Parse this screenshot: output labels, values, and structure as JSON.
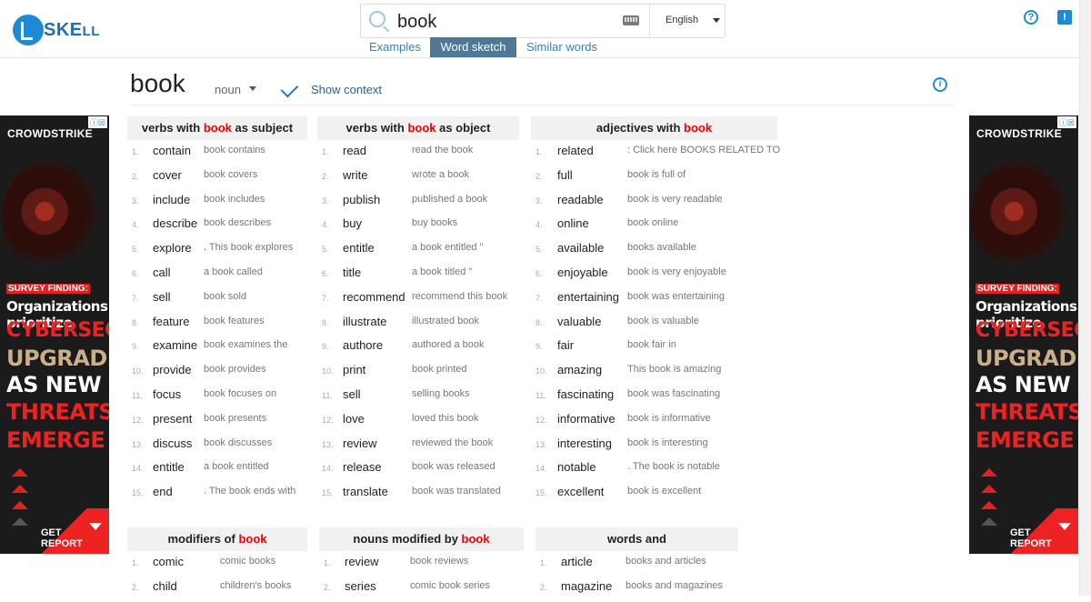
{
  "app": {
    "logo_text": "SKE",
    "logo_suffix": "LL"
  },
  "search": {
    "query": "book",
    "language": "English"
  },
  "nav_tabs": [
    {
      "label": "Examples",
      "active": false
    },
    {
      "label": "Word sketch",
      "active": true
    },
    {
      "label": "Similar words",
      "active": false
    }
  ],
  "icons": {
    "help": "?",
    "feedback": "!",
    "info": "i"
  },
  "entry": {
    "headword": "book",
    "pos": "noun",
    "show_context_label": "Show context",
    "show_context_checked": true
  },
  "columns": [
    {
      "title_pre": "verbs with ",
      "title_kw": "book",
      "title_post": " as subject",
      "rows": [
        {
          "n": "1.",
          "w": "contain",
          "e": "book contains"
        },
        {
          "n": "2.",
          "w": "cover",
          "e": "book covers"
        },
        {
          "n": "3.",
          "w": "include",
          "e": "book includes"
        },
        {
          "n": "4.",
          "w": "describe",
          "e": "book describes"
        },
        {
          "n": "5.",
          "w": "explore",
          "e": ". This book explores"
        },
        {
          "n": "6.",
          "w": "call",
          "e": "a book called"
        },
        {
          "n": "7.",
          "w": "sell",
          "e": "book sold"
        },
        {
          "n": "8.",
          "w": "feature",
          "e": "book features"
        },
        {
          "n": "9.",
          "w": "examine",
          "e": "book examines the"
        },
        {
          "n": "10.",
          "w": "provide",
          "e": "book provides"
        },
        {
          "n": "11.",
          "w": "focus",
          "e": "book focuses on"
        },
        {
          "n": "12.",
          "w": "present",
          "e": "book presents"
        },
        {
          "n": "13.",
          "w": "discuss",
          "e": "book discusses"
        },
        {
          "n": "14.",
          "w": "entitle",
          "e": "a book entitled"
        },
        {
          "n": "15.",
          "w": "end",
          "e": ". The book ends with"
        }
      ]
    },
    {
      "title_pre": "verbs with ",
      "title_kw": "book",
      "title_post": " as object",
      "rows": [
        {
          "n": "1.",
          "w": "read",
          "e": "read the book"
        },
        {
          "n": "2.",
          "w": "write",
          "e": "wrote a book"
        },
        {
          "n": "3.",
          "w": "publish",
          "e": "published a book"
        },
        {
          "n": "4.",
          "w": "buy",
          "e": "buy books"
        },
        {
          "n": "5.",
          "w": "entitle",
          "e": "a book entitled \""
        },
        {
          "n": "6.",
          "w": "title",
          "e": "a book titled \""
        },
        {
          "n": "7.",
          "w": "recommend",
          "e": "recommend this book"
        },
        {
          "n": "8.",
          "w": "illustrate",
          "e": "illustrated book"
        },
        {
          "n": "9.",
          "w": "authore",
          "e": "authored a book"
        },
        {
          "n": "10.",
          "w": "print",
          "e": "book printed"
        },
        {
          "n": "11.",
          "w": "sell",
          "e": "selling books"
        },
        {
          "n": "12.",
          "w": "love",
          "e": "loved this book"
        },
        {
          "n": "13.",
          "w": "review",
          "e": "reviewed the book"
        },
        {
          "n": "14.",
          "w": "release",
          "e": "book was released"
        },
        {
          "n": "15.",
          "w": "translate",
          "e": "book was translated"
        }
      ]
    },
    {
      "title_pre": "adjectives with ",
      "title_kw": "book",
      "title_post": "",
      "rows": [
        {
          "n": "1.",
          "w": "related",
          "e": ": Click here BOOKS RELATED TO"
        },
        {
          "n": "2.",
          "w": "full",
          "e": "book is full of"
        },
        {
          "n": "3.",
          "w": "readable",
          "e": "book is very readable"
        },
        {
          "n": "4.",
          "w": "online",
          "e": "book online"
        },
        {
          "n": "5.",
          "w": "available",
          "e": "books available"
        },
        {
          "n": "6.",
          "w": "enjoyable",
          "e": "book is very enjoyable"
        },
        {
          "n": "7.",
          "w": "entertaining",
          "e": "book was entertaining"
        },
        {
          "n": "8.",
          "w": "valuable",
          "e": "book is valuable"
        },
        {
          "n": "9.",
          "w": "fair",
          "e": "book fair in"
        },
        {
          "n": "10.",
          "w": "amazing",
          "e": "This book is amazing"
        },
        {
          "n": "11.",
          "w": "fascinating",
          "e": "book was fascinating"
        },
        {
          "n": "12.",
          "w": "informative",
          "e": "book is informative"
        },
        {
          "n": "13.",
          "w": "interesting",
          "e": "book is interesting"
        },
        {
          "n": "14.",
          "w": "notable",
          "e": ". The book is notable"
        },
        {
          "n": "15.",
          "w": "excellent",
          "e": "book is excellent"
        }
      ]
    },
    {
      "title_pre": "modifiers of ",
      "title_kw": "book",
      "title_post": "",
      "rows": [
        {
          "n": "1.",
          "w": "comic",
          "e": "comic books"
        },
        {
          "n": "2.",
          "w": "child",
          "e": "children's books"
        }
      ]
    },
    {
      "title_pre": "nouns modified by ",
      "title_kw": "book",
      "title_post": "",
      "rows": [
        {
          "n": "1.",
          "w": "review",
          "e": "book reviews"
        },
        {
          "n": "2.",
          "w": "series",
          "e": "comic book series"
        }
      ]
    },
    {
      "title_pre": "words and",
      "title_kw": "",
      "title_post": "",
      "rows": [
        {
          "n": "1.",
          "w": "article",
          "e": "books and articles"
        },
        {
          "n": "2.",
          "w": "magazine",
          "e": "books and magazines"
        }
      ]
    }
  ],
  "ad": {
    "brand": "CROWDSTRIKE",
    "survey": "SURVEY FINDING:",
    "line1": "Organizations prioritize",
    "line2": "CYBERSECURITY",
    "line3": "UPGRADES",
    "line4": "AS NEW",
    "line5": "THREATS",
    "line6": "EMERGE",
    "cta": "GET REPORT",
    "badge": "ⓘ☒",
    "colors": {
      "accent": "#dd2222",
      "muted": "#c9b08a",
      "background": "#1b1b1b"
    }
  }
}
